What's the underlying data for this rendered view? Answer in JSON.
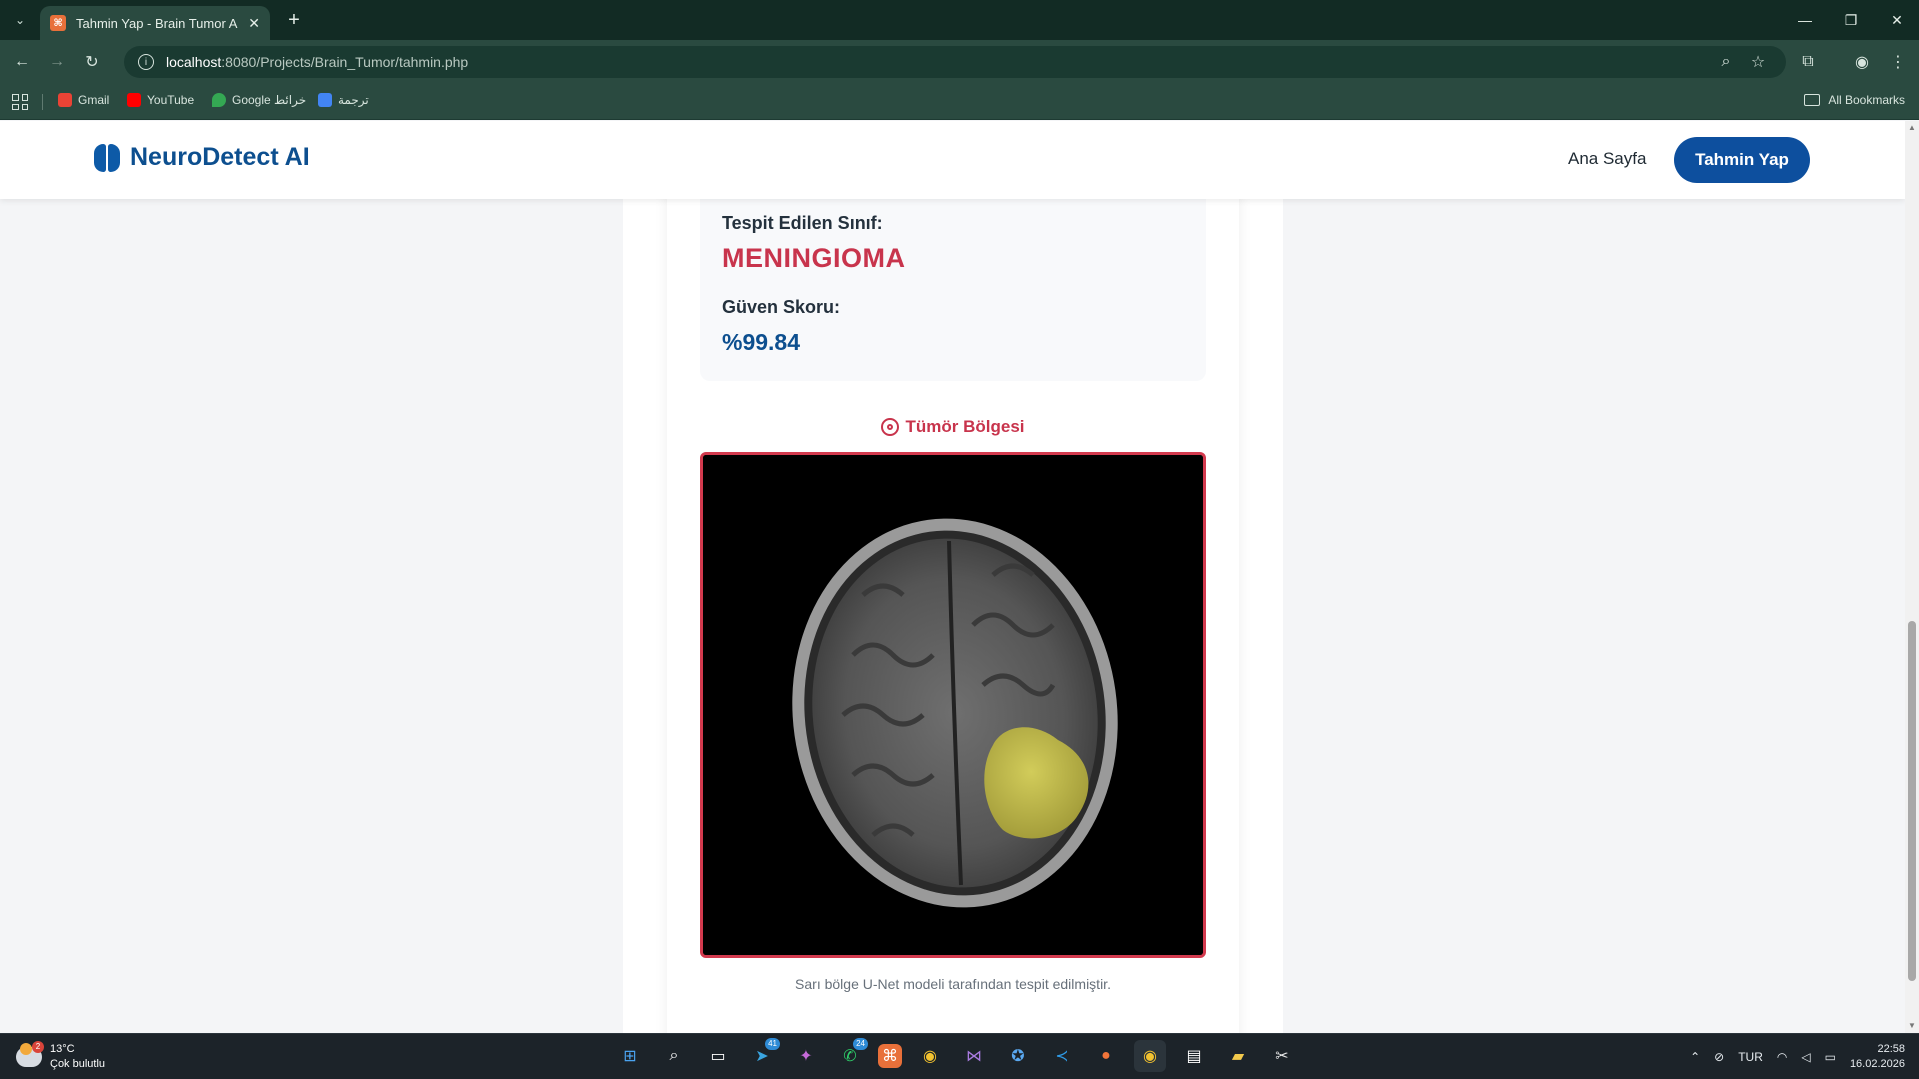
{
  "browser": {
    "tab_title": "Tahmin Yap - Brain Tumor AI",
    "tab_favicon_glyph": "⌘",
    "url_host": "localhost",
    "url_rest": ":8080/Projects/Brain_Tumor/tahmin.php",
    "bookmarks": [
      {
        "label": "Gmail",
        "color": "#ea4335"
      },
      {
        "label": "YouTube",
        "color": "#ff0000"
      },
      {
        "label": "Google خرائط",
        "color": "#34a853"
      },
      {
        "label": "ترجمة",
        "color": "#4285f4"
      }
    ],
    "all_bookmarks": "All Bookmarks"
  },
  "app": {
    "brand": "NeuroDetect AI",
    "nav_home": "Ana Sayfa",
    "nav_predict": "Tahmin Yap"
  },
  "result": {
    "class_label": "Tespit Edilen Sınıf:",
    "class_value": "MENINGIOMA",
    "score_label": "Güven Skoru:",
    "score_value": "%99.84",
    "region_title": "Tümör Bölgesi",
    "caption": "Sarı bölge U-Net modeli tarafından tespit edilmiştir."
  },
  "colors": {
    "brand_blue": "#0d4f9e",
    "accent_red": "#c8344c",
    "tumor_yellow": "#c9c24a"
  },
  "taskbar": {
    "temperature": "13°C",
    "weather_desc": "Çok bulutlu",
    "weather_badge": "2",
    "language": "TUR",
    "time": "22:58",
    "date": "16.02.2026",
    "badge_telegram": "41",
    "badge_whatsapp": "24"
  }
}
